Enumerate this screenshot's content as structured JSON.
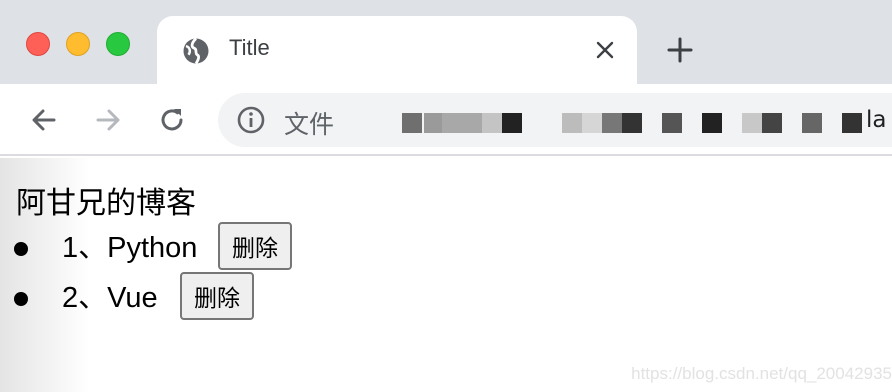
{
  "browser": {
    "tab": {
      "title": "Title"
    },
    "address_bar": {
      "security_label": "文件",
      "url_visible_tail": "la"
    }
  },
  "page": {
    "heading": "阿甘兄的博客",
    "items": [
      {
        "text": "1、Python",
        "button_label": "删除"
      },
      {
        "text": "2、Vue",
        "button_label": "删除"
      }
    ],
    "watermark": "https://blog.csdn.net/qq_20042935"
  },
  "icons": {
    "traffic_lights": [
      "close-window-icon",
      "minimize-window-icon",
      "maximize-window-icon"
    ],
    "tab": [
      "globe-icon",
      "close-icon"
    ],
    "toolbar": [
      "back-arrow-icon",
      "forward-arrow-icon",
      "reload-icon",
      "info-icon",
      "plus-icon"
    ]
  },
  "colors": {
    "titlebar": "#dee1e6",
    "omnibox": "#f1f3f4",
    "traffic_red": "#fe5f57",
    "traffic_yellow": "#febc2e",
    "traffic_green": "#28c840",
    "button_bg": "#efefef",
    "button_border": "#767676"
  }
}
